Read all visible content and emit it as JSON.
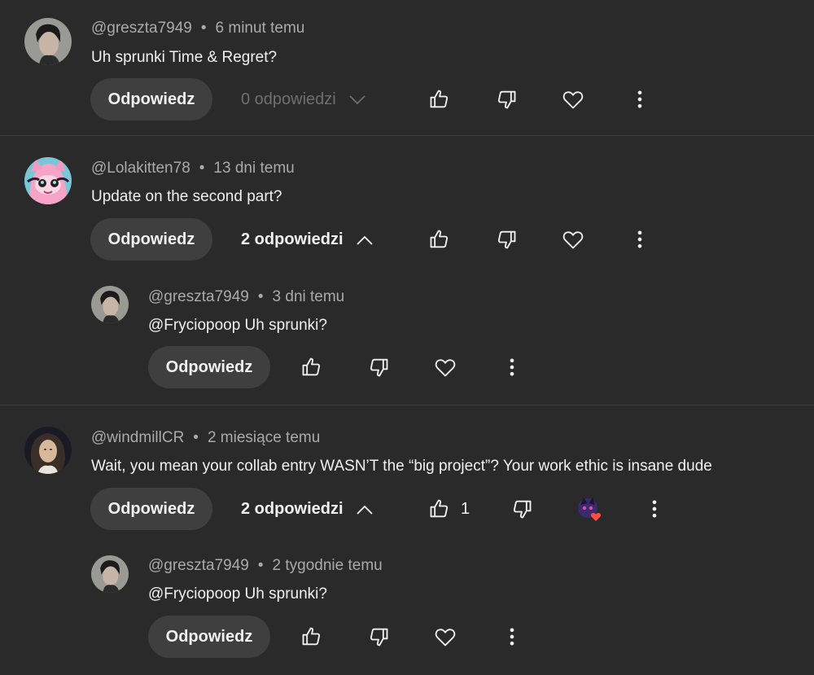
{
  "comments": [
    {
      "username": "@greszta7949",
      "time": "6 minut temu",
      "text": "Uh sprunki Time & Regret?",
      "reply_label": "Odpowiedz",
      "replies_label": "0 odpowiedzi"
    },
    {
      "username": "@Lolakitten78",
      "time": "13 dni temu",
      "text": "Update on the second part?",
      "reply_label": "Odpowiedz",
      "replies_label": "2 odpowiedzi",
      "reply": {
        "username": "@greszta7949",
        "time": "3 dni temu",
        "text": "@Fryciopoop Uh sprunki?",
        "reply_label": "Odpowiedz"
      }
    },
    {
      "username": "@windmillCR",
      "time": "2 miesiące temu",
      "text": "Wait, you mean your collab entry WASN’T the “big project”? Your work ethic is insane dude",
      "reply_label": "Odpowiedz",
      "replies_label": "2 odpowiedzi",
      "like_count": "1",
      "reply": {
        "username": "@greszta7949",
        "time": "2 tygodnie temu",
        "text": "@Fryciopoop Uh sprunki?",
        "reply_label": "Odpowiedz"
      }
    }
  ],
  "separator": "•",
  "icons": [
    "like-icon",
    "dislike-icon",
    "heart-icon",
    "more-vert-icon",
    "chevron-down-icon",
    "chevron-up-icon",
    "creator-heart-icon"
  ],
  "colors": {
    "background": "#2a2a2a",
    "button": "#3f3f3f",
    "meta": "#aaaaaa",
    "heart": "#ff4e45"
  }
}
